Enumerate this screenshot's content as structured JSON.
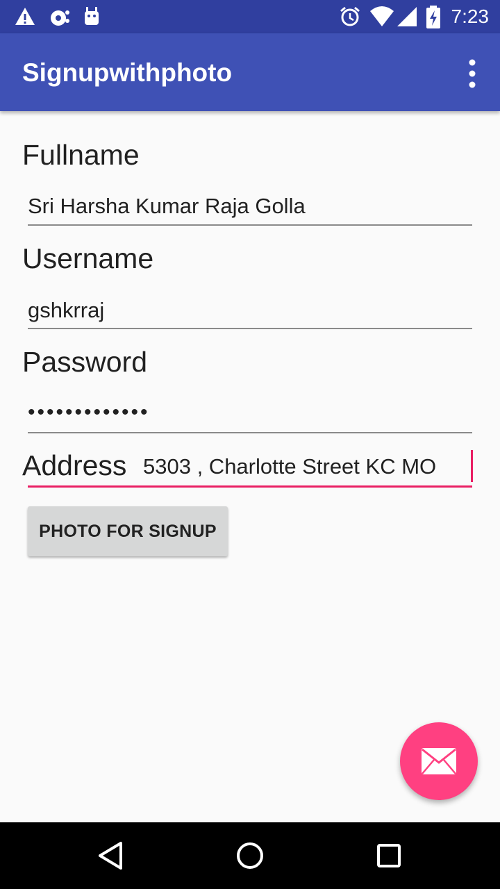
{
  "status_bar": {
    "time": "7:23",
    "left_icons": [
      "warning-icon",
      "cloud-sync-icon",
      "android-icon"
    ],
    "right_icons": [
      "alarm-icon",
      "wifi-icon",
      "signal-icon",
      "battery-charging-icon"
    ]
  },
  "app_bar": {
    "title": "Signupwithphoto",
    "overflow_icon": "more-vert-icon"
  },
  "form": {
    "fullname": {
      "label": "Fullname",
      "value": "Sri Harsha Kumar Raja Golla"
    },
    "username": {
      "label": "Username",
      "value": "gshkrraj"
    },
    "password": {
      "label": "Password",
      "value": "•••••••••••••"
    },
    "address": {
      "label": "Address",
      "value": "5303 , Charlotte Street KC MO"
    }
  },
  "photo_button": {
    "label": "PHOTO FOR SIGNUP"
  },
  "fab": {
    "icon": "mail-icon"
  },
  "nav_bar": {
    "icons": [
      "back-icon",
      "home-icon",
      "recents-icon"
    ]
  },
  "colors": {
    "primary": "#3F51B5",
    "primary_dark": "#303F9F",
    "accent": "#FF4081",
    "focus_underline": "#E91E63"
  }
}
